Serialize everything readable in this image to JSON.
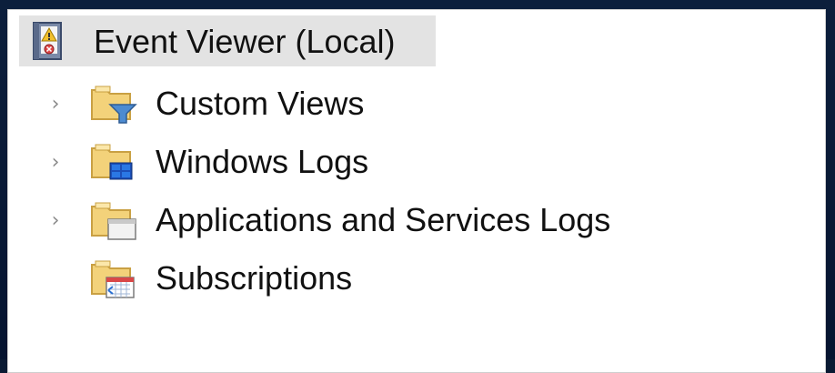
{
  "tree": {
    "root": {
      "label": "Event Viewer (Local)",
      "icon": "event-viewer-icon"
    },
    "items": [
      {
        "label": "Custom Views",
        "icon": "folder-filter-icon",
        "expandable": true
      },
      {
        "label": "Windows Logs",
        "icon": "folder-windows-icon",
        "expandable": true
      },
      {
        "label": "Applications and Services Logs",
        "icon": "folder-window-icon",
        "expandable": true
      },
      {
        "label": "Subscriptions",
        "icon": "folder-calendar-icon",
        "expandable": false
      }
    ]
  },
  "colors": {
    "selection_background": "#e3e3e3",
    "folder_yellow": "#f3d27a",
    "window_background": "#0a1a33"
  }
}
